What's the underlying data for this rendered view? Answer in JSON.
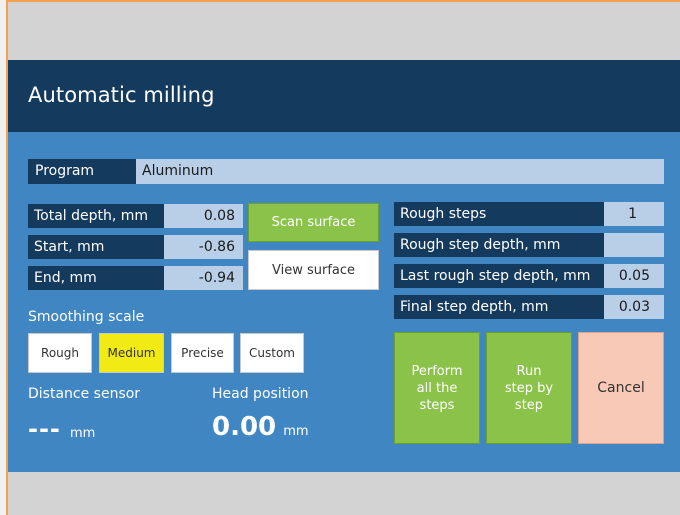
{
  "window": {
    "title": "Automatic milling"
  },
  "program": {
    "label": "Program",
    "value": "Aluminum"
  },
  "depth_fields": [
    {
      "label": "Total depth, mm",
      "value": "0.08"
    },
    {
      "label": "Start, mm",
      "value": "-0.86"
    },
    {
      "label": "End, mm",
      "value": "-0.94"
    }
  ],
  "surface_buttons": {
    "scan": "Scan surface",
    "view": "View surface"
  },
  "smoothing": {
    "label": "Smoothing scale",
    "options": [
      "Rough",
      "Medium",
      "Precise",
      "Custom"
    ],
    "selected": "Medium"
  },
  "distance_sensor": {
    "label": "Distance sensor",
    "value": "---",
    "unit": "mm"
  },
  "head_position": {
    "label": "Head position",
    "value": "0.00",
    "unit": "mm"
  },
  "step_fields": [
    {
      "label": "Rough steps",
      "value": "1"
    },
    {
      "label": "Rough step depth, mm",
      "value": ""
    },
    {
      "label": "Last rough step depth, mm",
      "value": "0.05"
    },
    {
      "label": "Final step depth, mm",
      "value": "0.03"
    }
  ],
  "actions": {
    "perform_all": "Perform\nall the\nsteps",
    "run_step": "Run\nstep by\nstep",
    "cancel": "Cancel"
  },
  "colors": {
    "title_bar": "#143a5e",
    "panel": "#3f86c2",
    "green_button": "#8bc34a",
    "selected_option": "#f2ea14",
    "cancel_button": "#f8c9b6"
  }
}
